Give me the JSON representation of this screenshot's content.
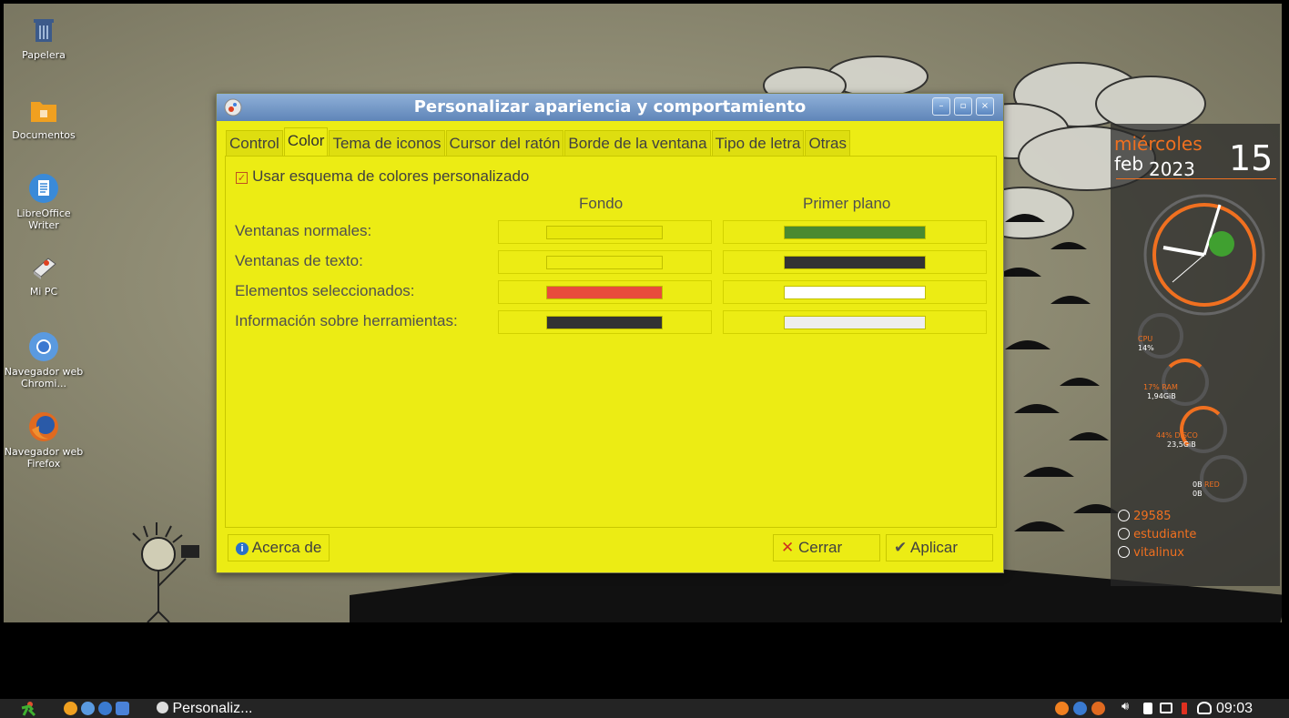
{
  "desktop": {
    "icons": [
      {
        "label": "Papelera"
      },
      {
        "label": "Documentos"
      },
      {
        "label": "LibreOffice Writer"
      },
      {
        "label": "Mi PC"
      },
      {
        "label": "Navegador web Chromi..."
      },
      {
        "label": "Navegador web Firefox"
      }
    ]
  },
  "conky": {
    "weekday": "miércoles",
    "month": "feb",
    "year": "2023",
    "day": "15",
    "cpu_label": "CPU",
    "cpu_value": "14%",
    "ram_label": "17% RAM",
    "ram_value": "1,94GiB",
    "disk_label": "44% DISCO",
    "disk_value": "23,5GiB",
    "net_down": "0B",
    "net_label": "RED",
    "net_up": "0B",
    "uptime": "29585",
    "user": "estudiante",
    "host": "vitalinux",
    "gauges": {
      "cpu": 0.14,
      "ram": 0.17,
      "disk": 0.44,
      "net": 0.0
    }
  },
  "dialog": {
    "title": "Personalizar apariencia y comportamiento",
    "tabs": [
      "Control",
      "Color",
      "Tema de iconos",
      "Cursor del ratón",
      "Borde de la ventana",
      "Tipo de letra",
      "Otras"
    ],
    "active_tab": "Color",
    "custom_scheme_checkbox": {
      "label": "Usar esquema de colores personalizado",
      "checked": true
    },
    "column_headers": {
      "background": "Fondo",
      "foreground": "Primer plano"
    },
    "rows": [
      {
        "label": "Ventanas normales:",
        "background": "#e8e80c",
        "foreground": "#4a8a30"
      },
      {
        "label": "Ventanas de texto:",
        "background": "#ecec14",
        "foreground": "#333333"
      },
      {
        "label": "Elementos seleccionados:",
        "background": "#e84c3c",
        "foreground": "#ffffff"
      },
      {
        "label": "Información sobre herramientas:",
        "background": "#333333",
        "foreground": "#eeeeee"
      }
    ],
    "buttons": {
      "about": "Acerca de",
      "close": "Cerrar",
      "apply": "Aplicar"
    }
  },
  "taskbar": {
    "window_button": "Personaliz...",
    "clock": "09:03"
  },
  "colors": {
    "dialog_bg": "#ecec14",
    "titlebar": "#5f85b8",
    "accent_orange": "#f07020"
  }
}
